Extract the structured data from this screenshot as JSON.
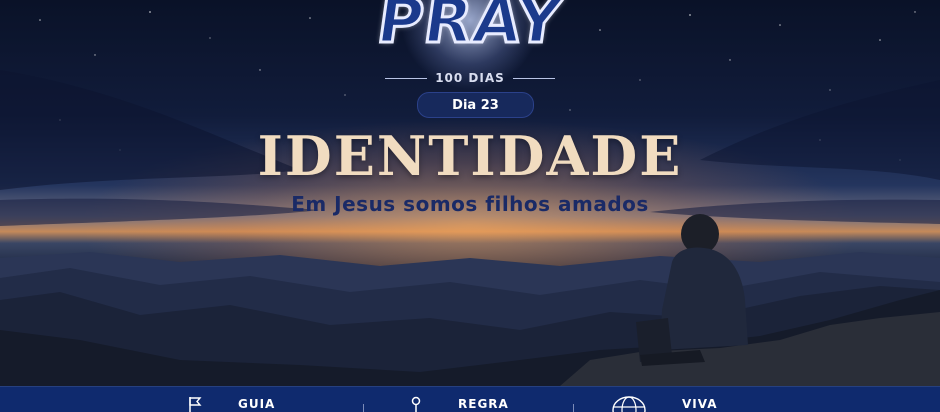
{
  "logo": {
    "text": "PRAY"
  },
  "program": {
    "days": "100 DIAS",
    "day": "Dia 23"
  },
  "headline": {
    "title": "IDENTIDADE",
    "subtitle": "Em Jesus somos filhos amados"
  },
  "bottom_bar": {
    "items": [
      {
        "icon": "flag-icon",
        "label": "GUIA"
      },
      {
        "icon": "pin-icon",
        "label": "REGRA"
      },
      {
        "icon": "globe-icon",
        "label": "VIVA"
      }
    ]
  },
  "colors": {
    "bar": "#0f2a6e",
    "title": "#f1dcc0",
    "subtitle": "#1a2a66",
    "pill": "#17295c"
  }
}
